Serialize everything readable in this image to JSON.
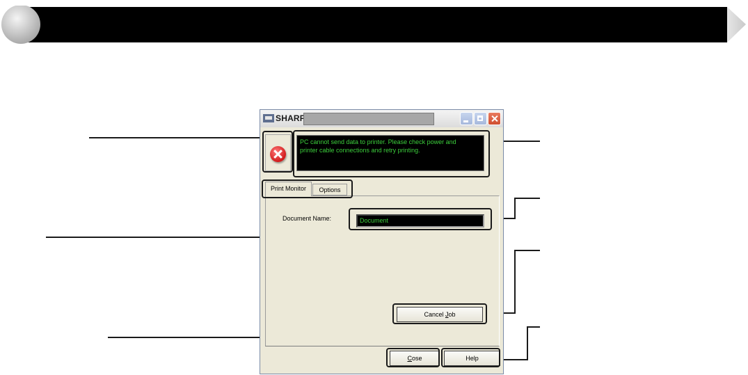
{
  "window": {
    "title": "SHARP",
    "icon": "printer-app-icon"
  },
  "window_controls": {
    "minimize": "minimize-icon",
    "maximize": "maximize-icon",
    "close": "close-icon"
  },
  "status": {
    "icon": "error-icon",
    "message_line1": "PC cannot send data to printer. Please check power and",
    "message_line2": "printer cable connections and retry printing."
  },
  "tabs": [
    {
      "label": "Print Monitor",
      "active": true
    },
    {
      "label": "Options",
      "active": false
    }
  ],
  "document": {
    "label": "Document Name:",
    "value": "Document"
  },
  "buttons": {
    "cancel_job_prefix": "Cancel ",
    "cancel_job_underlined": "J",
    "cancel_job_suffix": "ob",
    "close_prefix": "C",
    "close_suffix": "ose",
    "help": "Help"
  },
  "colors": {
    "banner": "#000000",
    "message_text": "#3ccf3c",
    "dialog_bg": "#ece9d8",
    "callout": "#1a1a1a"
  }
}
